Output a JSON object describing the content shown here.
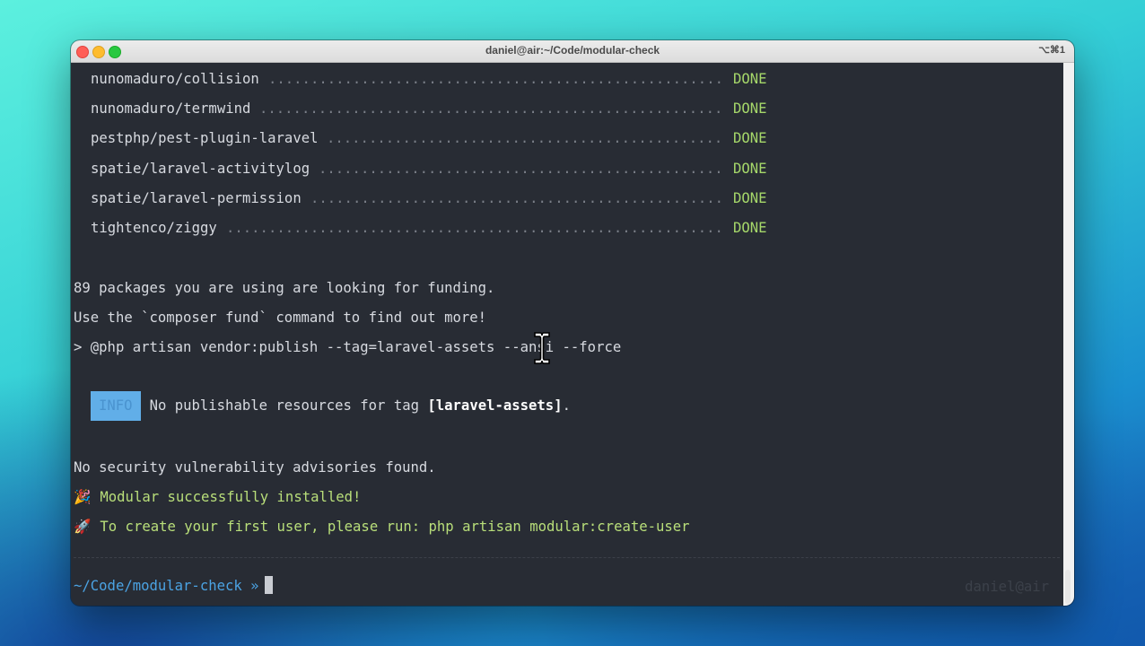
{
  "window": {
    "title": "daniel@air:~/Code/modular-check",
    "shortcut": "⌥⌘1"
  },
  "packages": [
    {
      "name": "nunomaduro/collision",
      "status": "DONE"
    },
    {
      "name": "nunomaduro/termwind",
      "status": "DONE"
    },
    {
      "name": "pestphp/pest-plugin-laravel",
      "status": "DONE"
    },
    {
      "name": "spatie/laravel-activitylog",
      "status": "DONE"
    },
    {
      "name": "spatie/laravel-permission",
      "status": "DONE"
    },
    {
      "name": "tightenco/ziggy",
      "status": "DONE"
    }
  ],
  "output": {
    "funding_line": "89 packages you are using are looking for funding.",
    "fund_hint": "Use the `composer fund` command to find out more!",
    "publish_cmd": "> @php artisan vendor:publish --tag=laravel-assets --ansi --force",
    "info_badge": "INFO",
    "info_prefix": "No publishable resources for tag ",
    "info_tag": "[laravel-assets]",
    "info_suffix": ".",
    "security": "No security vulnerability advisories found.",
    "success_emoji": "🎉",
    "success": "Modular successfully installed!",
    "rocket_emoji": "🚀",
    "create_user": "To create your first user, please run: php artisan modular:create-user"
  },
  "prompt": {
    "path": "~/Code/modular-check",
    "symbol": "»",
    "right": "daniel@air"
  }
}
